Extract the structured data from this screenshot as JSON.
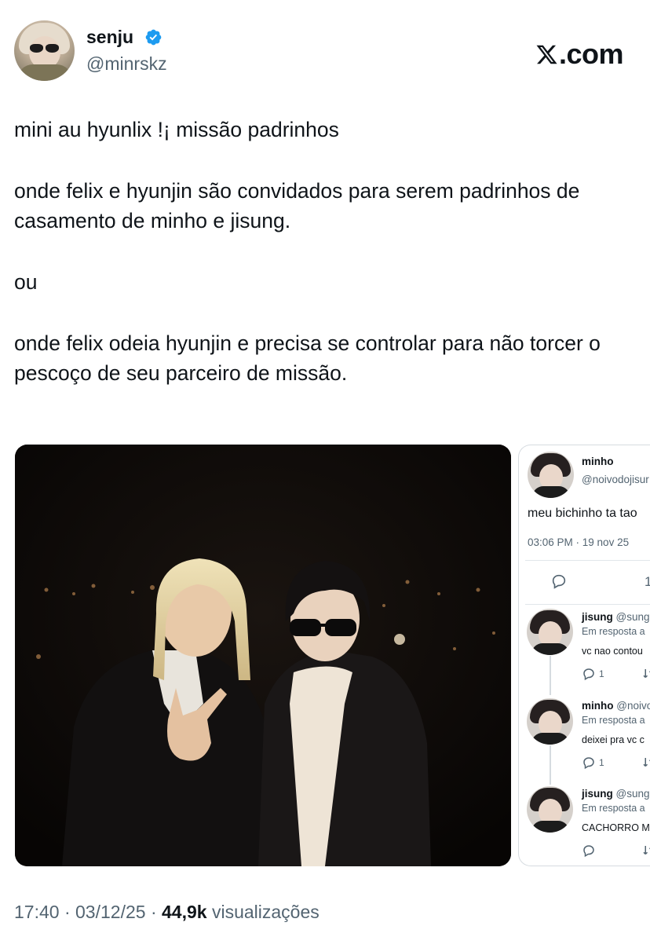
{
  "author": {
    "display_name": "senju",
    "handle": "@minrskz",
    "verified": true
  },
  "brand": {
    "logo_text": ".com"
  },
  "tweet": {
    "paragraphs": [
      "mini au hyunlix !¡ missão padrinhos",
      "onde felix e hyunjin são convidados para serem padrinhos de casamento de minho e jisung.",
      "ou",
      "onde felix odeia hyunjin e precisa se controlar para não torcer o pescoço de seu parceiro de missão."
    ]
  },
  "media": {
    "thread": {
      "main_post": {
        "name": "minho",
        "handle": "@noivodojisur",
        "text": "meu bichinho ta tao",
        "timestamp": "03:06 PM · 19 nov 25",
        "reply_count": "1"
      },
      "replies": [
        {
          "name": "jisung",
          "handle": "@sung",
          "reply_to": "Em resposta a",
          "text": "vc nao contou",
          "reply_count": "1"
        },
        {
          "name": "minho",
          "handle": "@noivo",
          "reply_to": "Em resposta a",
          "text": "deixei pra vc c",
          "reply_count": "1"
        },
        {
          "name": "jisung",
          "handle": "@sung",
          "reply_to": "Em resposta a",
          "text": "CACHORRO M",
          "reply_count": ""
        }
      ]
    }
  },
  "footer": {
    "time": "17:40",
    "separator": "·",
    "date": "03/12/25",
    "views_count": "44,9k",
    "views_label": "visualizações"
  },
  "colors": {
    "text": "#0f1419",
    "secondary": "#536471",
    "verified": "#1d9bf0",
    "border": "#d6dbe0"
  }
}
